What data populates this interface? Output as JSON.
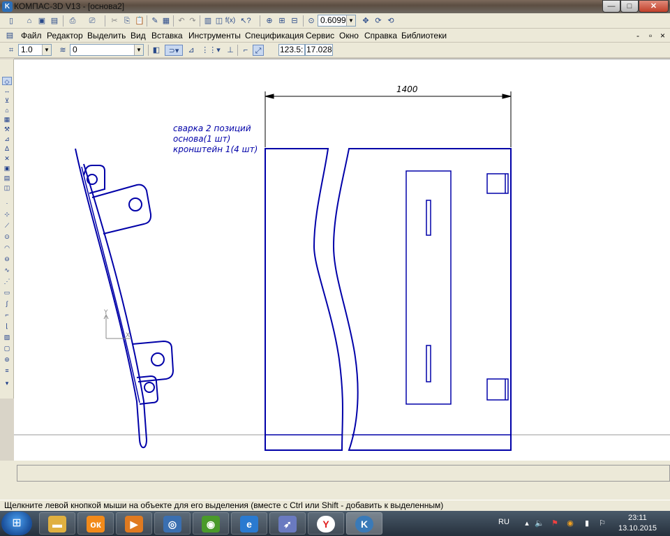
{
  "window": {
    "title": "КОМПАС-3D V13 - [основа2]",
    "app_icon": "kompas-logo-icon",
    "buttons": {
      "minimize": "—",
      "maximize": "□",
      "close": "✕"
    }
  },
  "toolbar_top": {
    "zoom_value": "0.6099"
  },
  "menu": {
    "items": [
      "Файл",
      "Редактор",
      "Выделить",
      "Вид",
      "Вставка",
      "Инструменты",
      "Спецификация",
      "Сервис",
      "Окно",
      "Справка",
      "Библиотеки"
    ],
    "doc_controls": {
      "minimize": "-",
      "restore": "▫",
      "close": "×"
    }
  },
  "props_toolbar": {
    "scale_value": "1.0",
    "layer_value": "0",
    "x_label": "x",
    "x_value": "123.5:",
    "y_value": "17.028"
  },
  "drawing": {
    "dimension_label": "1400",
    "note_lines": [
      "сварка 2 позиций",
      "основа(1 шт)",
      "кронштейн 1(4 шт)"
    ],
    "axis_y": "Y",
    "axis_x": "X",
    "line_color": "#0000a8"
  },
  "statusbar": {
    "message": "Щелкните левой кнопкой мыши на объекте для его выделения (вместе с Ctrl или Shift - добавить к выделенным)"
  },
  "taskbar": {
    "apps": [
      {
        "name": "explorer",
        "icon": "folder-icon",
        "color": "#e0b040"
      },
      {
        "name": "odnoklassniki",
        "icon": "ok-icon",
        "color": "#f28a1a"
      },
      {
        "name": "media-player",
        "icon": "play-icon",
        "color": "#e07a20"
      },
      {
        "name": "app-blue",
        "icon": "app-blue-icon",
        "color": "#3a6fb0"
      },
      {
        "name": "nvidia",
        "icon": "nvidia-icon",
        "color": "#4a9a2a"
      },
      {
        "name": "internet-explorer",
        "icon": "ie-icon",
        "color": "#2a7ad0"
      },
      {
        "name": "app-rocket",
        "icon": "rocket-icon",
        "color": "#6a7ac0"
      },
      {
        "name": "yandex",
        "icon": "yandex-icon",
        "color": "#e02020"
      },
      {
        "name": "kompas",
        "icon": "kompas-icon",
        "color": "#3a7ab8"
      }
    ],
    "language": "RU",
    "time": "23:11",
    "date": "13.10.2015"
  }
}
